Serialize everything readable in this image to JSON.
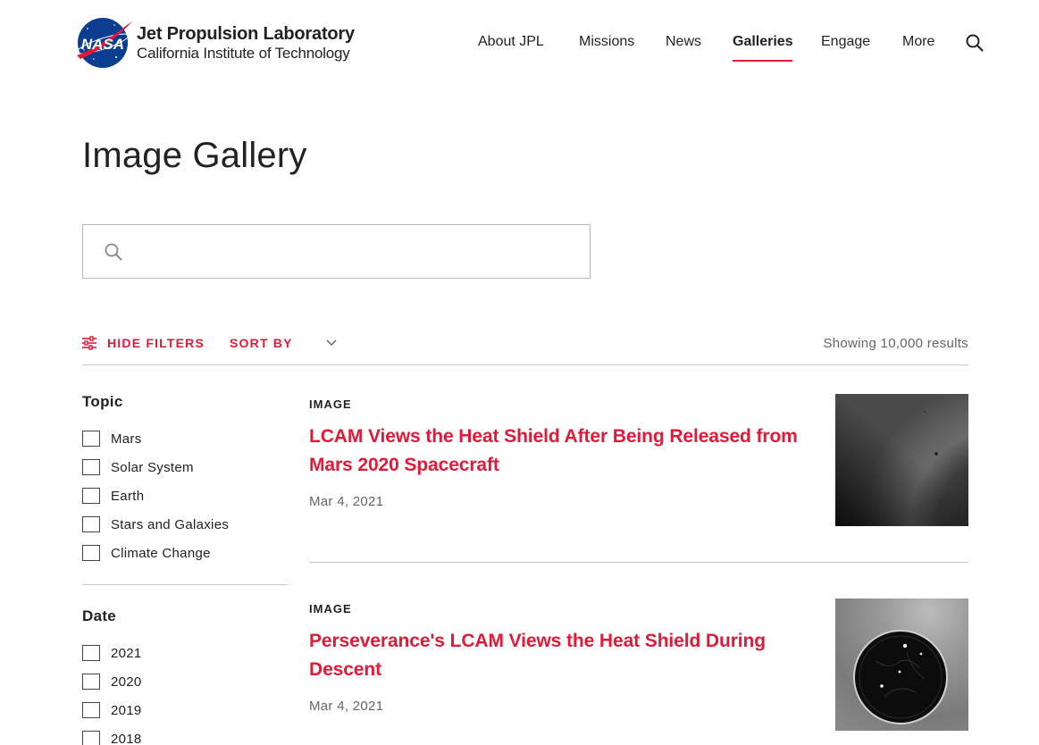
{
  "brand": {
    "nasa_text": "NASA",
    "title": "Jet Propulsion Laboratory",
    "subtitle": "California Institute of Technology"
  },
  "nav": {
    "items": [
      {
        "label": "About JPL",
        "active": false
      },
      {
        "label": "Missions",
        "active": false
      },
      {
        "label": "News",
        "active": false
      },
      {
        "label": "Galleries",
        "active": true
      },
      {
        "label": "Engage",
        "active": false
      },
      {
        "label": "More",
        "active": false
      }
    ],
    "search_icon": "search-icon"
  },
  "page": {
    "title": "Image Gallery"
  },
  "search": {
    "value": "",
    "placeholder": "",
    "icon": "search-icon"
  },
  "filter_bar": {
    "hide_filters_label": "HIDE FILTERS",
    "sort_by_label": "SORT BY",
    "results_text": "Showing 10,000 results"
  },
  "filters": {
    "topic": {
      "heading": "Topic",
      "options": [
        "Mars",
        "Solar System",
        "Earth",
        "Stars and Galaxies",
        "Climate Change"
      ]
    },
    "date": {
      "heading": "Date",
      "options": [
        "2021",
        "2020",
        "2019",
        "2018"
      ]
    }
  },
  "results": [
    {
      "type": "IMAGE",
      "title": "LCAM Views the Heat Shield After Being Released from Mars 2020 Spacecraft",
      "date": "Mar 4, 2021"
    },
    {
      "type": "IMAGE",
      "title": "Perseverance's LCAM Views the Heat Shield During Descent",
      "date": "Mar 4, 2021"
    }
  ],
  "colors": {
    "accent": "#e31937",
    "nasa_blue": "#0b3d91",
    "text": "#222222",
    "muted": "#666666"
  }
}
